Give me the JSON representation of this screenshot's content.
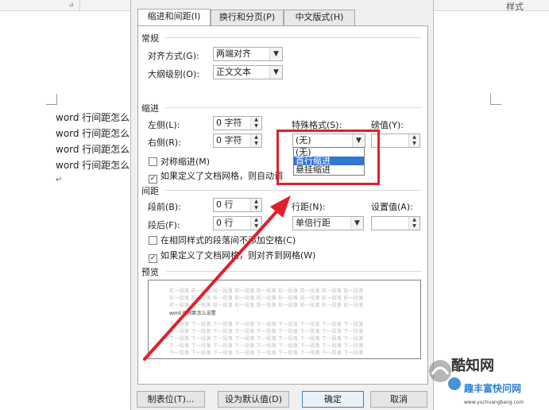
{
  "ribbon": {
    "launcher_icon": "dialog-launcher-icon",
    "style_label": "样式"
  },
  "document": {
    "lines": [
      "word 行间距怎么",
      "word 行间距怎么",
      "word 行间距怎么",
      "word 行间距怎么"
    ],
    "paragraph_mark": "↵"
  },
  "dialog": {
    "tabs": [
      "缩进和间距(I)",
      "换行和分页(P)",
      "中文版式(H)"
    ],
    "general": {
      "title": "常规",
      "alignment_label": "对齐方式(G):",
      "alignment_value": "两端对齐",
      "outline_label": "大纲级别(O):",
      "outline_value": "正文文本"
    },
    "indent": {
      "title": "缩进",
      "left_label": "左侧(L):",
      "left_value": "0 字符",
      "right_label": "右侧(R):",
      "right_value": "0 字符",
      "special_label": "特殊格式(S):",
      "special_value": "(无)",
      "by_label": "磅值(Y):",
      "by_value": "",
      "dropdown_options": [
        "(无)",
        "首行缩进",
        "悬挂缩进"
      ],
      "dropdown_selected_index": 1,
      "mirror_label": "对称缩进(M)",
      "mirror_checked": false,
      "grid_label": "如果定义了文档网格，则自动调整右缩进(D)",
      "grid_checked": true
    },
    "spacing": {
      "title": "间距",
      "before_label": "段前(B):",
      "before_value": "0 行",
      "after_label": "段后(F):",
      "after_value": "0 行",
      "line_label": "行距(N):",
      "line_value": "单倍行距",
      "at_label": "设置值(A):",
      "at_value": "",
      "no_space_label": "在相同样式的段落间不添加空格(C)",
      "no_space_checked": false,
      "snap_label": "如果定义了文档网格，则对齐到网格(W)",
      "snap_checked": true
    },
    "preview": {
      "title": "预览",
      "sample_text": "word 行间距怎么设置",
      "filler_prev": "前一段落 前一段落 前一段落 前一段落 前一段落 前一段落 前一段落 前一段落 前一段落",
      "filler_next": "下一段落 下一段落 下一段落 下一段落 下一段落 下一段落 下一段落 下一段落 下一段落"
    },
    "buttons": {
      "tabs": "制表位(T)...",
      "set_default": "设为默认值(D)",
      "ok": "确定",
      "cancel": "取消"
    }
  },
  "annotation": {
    "highlight_color": "#e0202a"
  },
  "watermark": {
    "brand": "酷知网",
    "sub": "趣丰富快问网",
    "url": "www.yuchuangbang.com"
  }
}
